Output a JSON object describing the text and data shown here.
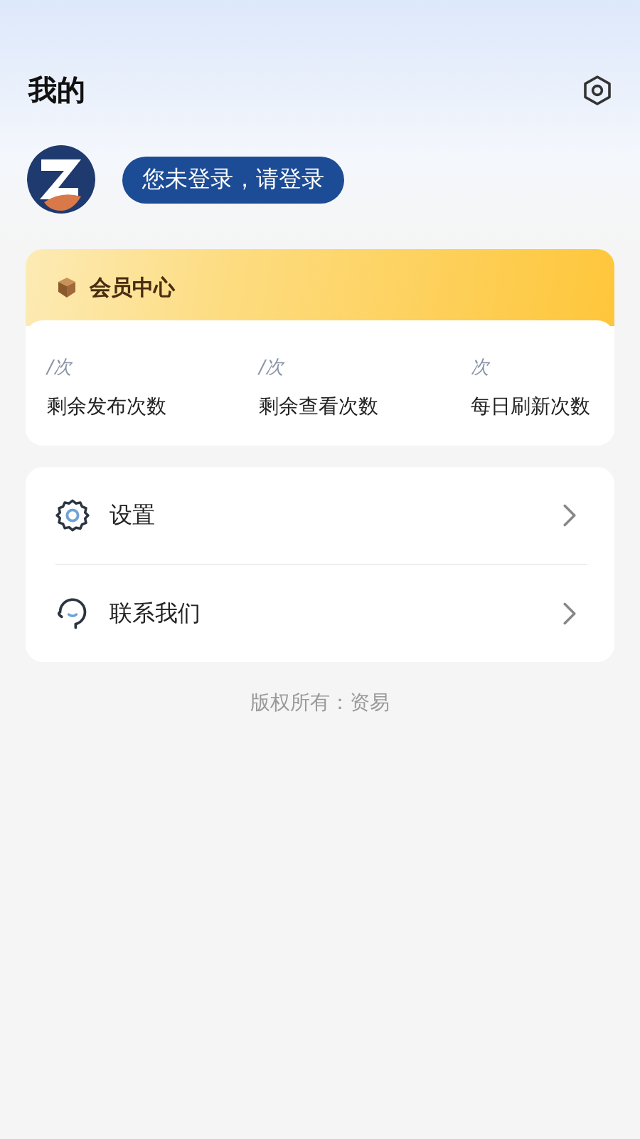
{
  "header": {
    "title": "我的"
  },
  "profile": {
    "login_prompt": "您未登录，请登录"
  },
  "member_card": {
    "title": "会员中心",
    "stats": [
      {
        "value": "/次",
        "label": "剩余发布次数"
      },
      {
        "value": "/次",
        "label": "剩余查看次数"
      },
      {
        "value": "次",
        "label": "每日刷新次数"
      }
    ]
  },
  "menu": [
    {
      "kind": "settings",
      "label": "设置"
    },
    {
      "kind": "contact",
      "label": "联系我们"
    }
  ],
  "footer": {
    "copyright": "版权所有：资易"
  }
}
